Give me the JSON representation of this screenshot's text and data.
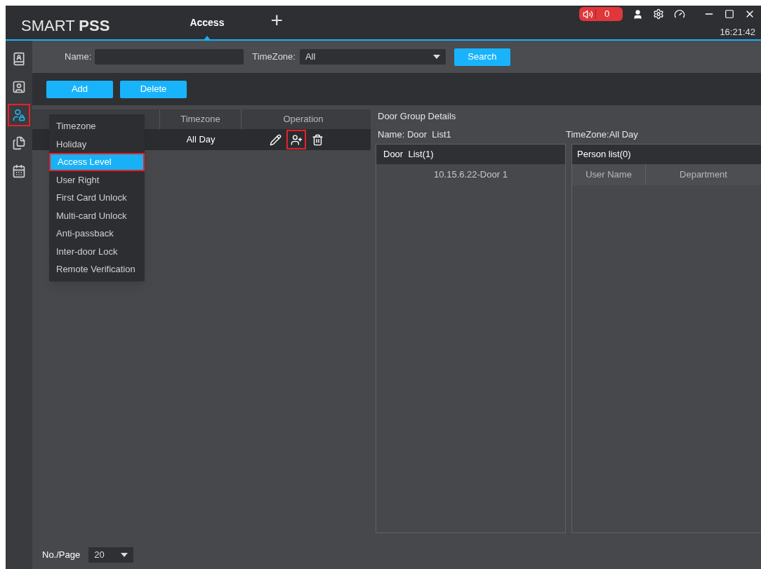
{
  "app": {
    "logo_light": "SMART",
    "logo_bold": "PSS",
    "tabs": [
      {
        "label": "Access",
        "selected": true
      }
    ],
    "add_tab": "+",
    "alarm_count": "0",
    "clock": "16:21:42"
  },
  "sidebar": {
    "items": [
      {
        "kind": "door",
        "selected": false,
        "highlighted": false
      },
      {
        "kind": "badge",
        "selected": false,
        "highlighted": false
      },
      {
        "kind": "user_lock",
        "selected": true,
        "highlighted": true
      },
      {
        "kind": "files",
        "selected": false,
        "highlighted": false
      },
      {
        "kind": "calendar",
        "selected": false,
        "highlighted": false
      }
    ]
  },
  "filter": {
    "name_label": "Name:",
    "timezone_label": "TimeZone:",
    "timezone_value": "All",
    "search_button": "Search"
  },
  "actions": [
    "Add",
    "Delete"
  ],
  "table": {
    "columns": [
      "Timezone",
      "Operation"
    ],
    "rows": [
      {
        "timezone": "All Day",
        "operations": [
          {
            "kind": "edit",
            "highlighted": false
          },
          {
            "kind": "add_person",
            "highlighted": true
          },
          {
            "kind": "delete",
            "highlighted": false
          }
        ]
      }
    ]
  },
  "menu": {
    "items": [
      {
        "label": "Timezone",
        "selected": false,
        "highlighted": false
      },
      {
        "label": "Holiday",
        "selected": false,
        "highlighted": false
      },
      {
        "label": "Access Level",
        "selected": true,
        "highlighted": true
      },
      {
        "label": "User Right",
        "selected": false,
        "highlighted": false
      },
      {
        "label": "First Card Unlock",
        "selected": false,
        "highlighted": false
      },
      {
        "label": "Multi-card Unlock",
        "selected": false,
        "highlighted": false
      },
      {
        "label": "Anti-passback",
        "selected": false,
        "highlighted": false
      },
      {
        "label": "Inter-door Lock",
        "selected": false,
        "highlighted": false
      },
      {
        "label": "Remote Verification",
        "selected": false,
        "highlighted": false
      }
    ]
  },
  "details": {
    "title": "Door Group Details",
    "name": "Name: Door  List1",
    "timezone": "TimeZone:All Day",
    "door_list": {
      "title": "Door  List(1)",
      "items": [
        "10.15.6.22-Door 1"
      ]
    },
    "person_list": {
      "title": "Person list(0)",
      "columns": [
        "User Name",
        "Department"
      ]
    }
  },
  "pager": {
    "label": "No./Page",
    "value": "20"
  }
}
